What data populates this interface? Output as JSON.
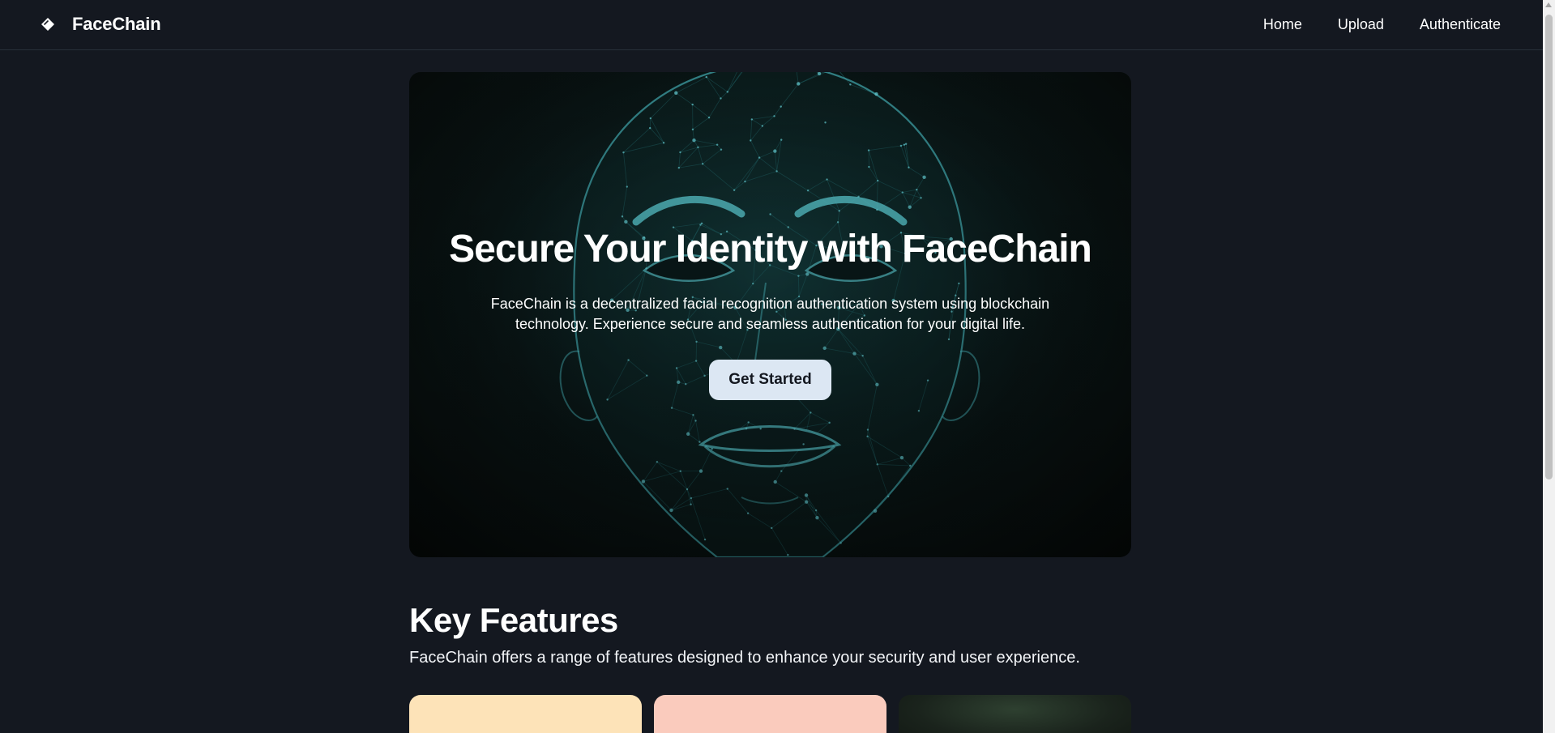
{
  "header": {
    "brand_name": "FaceChain",
    "nav": [
      {
        "label": "Home"
      },
      {
        "label": "Upload"
      },
      {
        "label": "Authenticate"
      }
    ]
  },
  "hero": {
    "title": "Secure Your Identity with FaceChain",
    "description": "FaceChain is a decentralized facial recognition authentication system using blockchain technology. Experience secure and seamless authentication for your digital life.",
    "cta_label": "Get Started"
  },
  "features": {
    "title": "Key Features",
    "subtitle": "FaceChain offers a range of features designed to enhance your security and user experience."
  },
  "colors": {
    "background": "#141820",
    "accent_button": "#dce7f3",
    "face_mesh": "#3ab7c0",
    "card_1": "#fde3b8",
    "card_2": "#facbbd",
    "card_3": "#1a231c"
  },
  "icons": {
    "brand": "diamond-tag-icon"
  }
}
